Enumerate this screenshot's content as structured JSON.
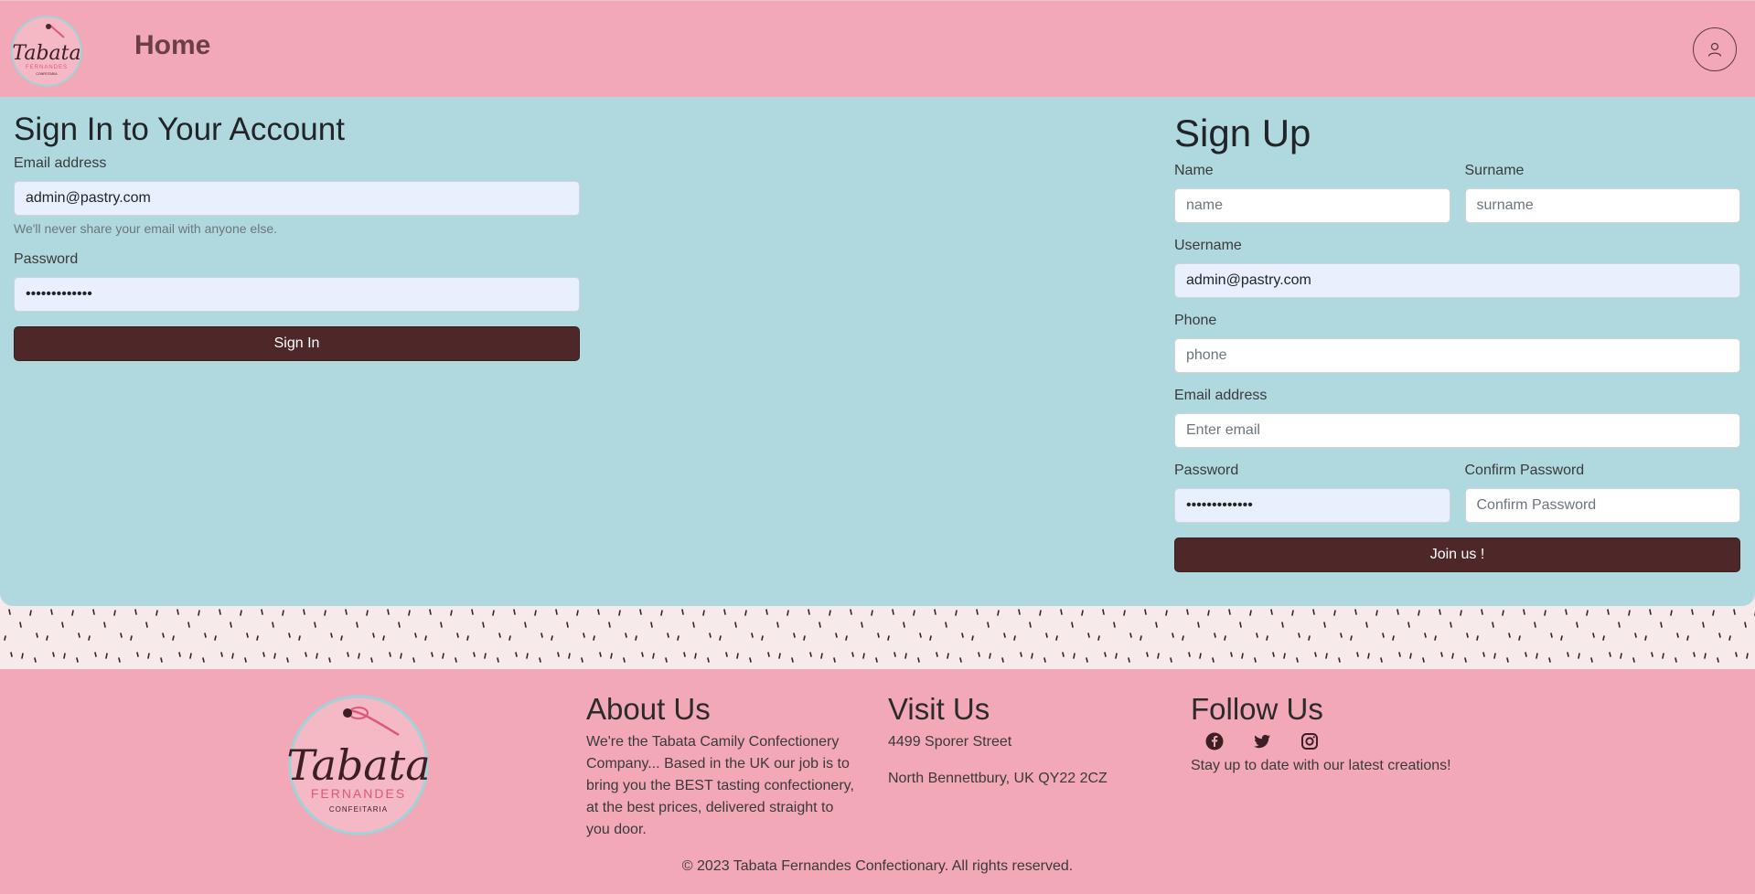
{
  "header": {
    "logo_text": "Tabata",
    "home_label": "Home",
    "user_icon": "user-icon"
  },
  "signin": {
    "title": "Sign In to Your Account",
    "email_label": "Email address",
    "email_value": "admin@pastry.com",
    "email_help": "We'll never share your email with anyone else.",
    "password_label": "Password",
    "password_value": "•••••••••••••",
    "button_label": "Sign In"
  },
  "signup": {
    "title": "Sign Up",
    "name_label": "Name",
    "name_placeholder": "name",
    "surname_label": "Surname",
    "surname_placeholder": "surname",
    "username_label": "Username",
    "username_value": "admin@pastry.com",
    "phone_label": "Phone",
    "phone_placeholder": "phone",
    "email_label": "Email address",
    "email_placeholder": "Enter email",
    "password_label": "Password",
    "password_value": "•••••••••••••",
    "confirm_label": "Confirm Password",
    "confirm_placeholder": "Confirm Password",
    "button_label": "Join us !"
  },
  "footer": {
    "logo_title": "Tabata",
    "logo_sub": "FERNANDES",
    "logo_sub2": "CONFEITARIA",
    "about_title": "About Us",
    "about_text": "We're the Tabata Camily Confectionery Company... Based in the UK our job is to bring you the BEST tasting confectionery, at the best prices, delivered straight to you door.",
    "visit_title": "Visit Us",
    "visit_street": "4499 Sporer Street",
    "visit_city": "North Bennettbury, UK QY22 2CZ",
    "follow_title": "Follow Us",
    "follow_text": "Stay up to date with our latest creations!",
    "social_icons": [
      "facebook-icon",
      "twitter-icon",
      "instagram-icon"
    ],
    "copyright": "© 2023 Tabata Fernandes Confectionary. All rights reserved."
  },
  "colors": {
    "header_bg": "#f2a8b7",
    "panel_bg": "#b0d9df",
    "button_bg": "#4e2729",
    "sprinkles_bg": "#f7eaea"
  }
}
